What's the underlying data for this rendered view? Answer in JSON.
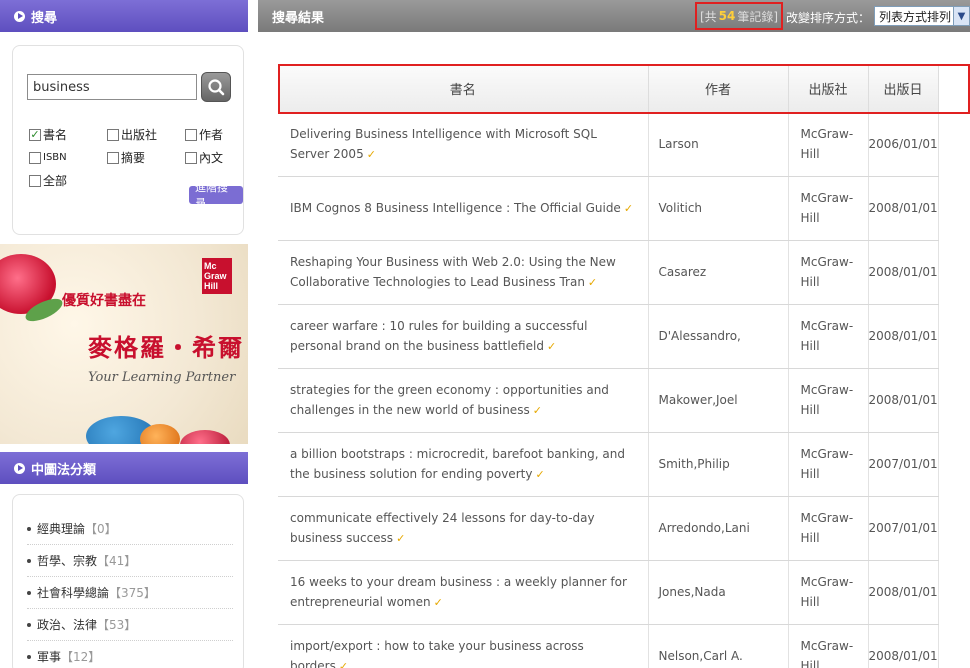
{
  "search_panel": {
    "title": "搜尋",
    "query": "business",
    "checkboxes": [
      {
        "label": "書名",
        "checked": true
      },
      {
        "label": "出版社",
        "checked": false
      },
      {
        "label": "作者",
        "checked": false
      },
      {
        "label": "ISBN",
        "checked": false
      },
      {
        "label": "摘要",
        "checked": false
      },
      {
        "label": "內文",
        "checked": false
      },
      {
        "label": "全部",
        "checked": false
      }
    ],
    "advanced_label": "進階搜尋"
  },
  "banner": {
    "logo_text": "Mc Graw Hill",
    "tagline": "優質好書盡在",
    "brand": "麥格羅・希爾",
    "slogan": "Your Learning Partner"
  },
  "class_panel": {
    "title": "中圖法分類",
    "items": [
      {
        "label": "經典理論",
        "count": "【0】"
      },
      {
        "label": "哲學、宗教",
        "count": "【41】"
      },
      {
        "label": "社會科學總論",
        "count": "【375】"
      },
      {
        "label": "政治、法律",
        "count": "【53】"
      },
      {
        "label": "軍事",
        "count": "【12】"
      }
    ]
  },
  "results": {
    "title": "搜尋結果",
    "count_prefix": "[共",
    "count_value": "54",
    "count_suffix": "筆記錄]",
    "sort_label": "改變排序方式：",
    "sort_selected": "列表方式排列",
    "columns": [
      "書名",
      "作者",
      "出版社",
      "出版日"
    ],
    "rows": [
      {
        "title": "Delivering Business Intelligence with Microsoft SQL Server 2005",
        "author": "Larson",
        "publisher": "McGraw-Hill",
        "date": "2006/01/01"
      },
      {
        "title": "IBM Cognos 8 Business Intelligence : The Official Guide",
        "author": "Volitich",
        "publisher": "McGraw-Hill",
        "date": "2008/01/01"
      },
      {
        "title": "Reshaping Your Business with Web 2.0: Using the New Collaborative Technologies to Lead Business Tran",
        "author": "Casarez",
        "publisher": "McGraw-Hill",
        "date": "2008/01/01"
      },
      {
        "title": "career warfare : 10 rules for building a successful personal brand on the business battlefield",
        "author": "D'Alessandro,",
        "publisher": "McGraw-Hill",
        "date": "2008/01/01"
      },
      {
        "title": "strategies for the green economy : opportunities and challenges in the new world of business",
        "author": "Makower,Joel",
        "publisher": "McGraw-Hill",
        "date": "2008/01/01"
      },
      {
        "title": "a billion bootstraps : microcredit, barefoot banking, and the business solution for ending poverty",
        "author": "Smith,Philip",
        "publisher": "McGraw-Hill",
        "date": "2007/01/01"
      },
      {
        "title": "communicate effectively 24 lessons for day-to-day business success",
        "author": "Arredondo,Lani",
        "publisher": "McGraw-Hill",
        "date": "2007/01/01"
      },
      {
        "title": "16 weeks to your dream business : a weekly planner for entrepreneurial women",
        "author": "Jones,Nada",
        "publisher": "McGraw-Hill",
        "date": "2008/01/01"
      },
      {
        "title": "import/export : how to take your business across borders",
        "author": "Nelson,Carl A.",
        "publisher": "McGraw-Hill",
        "date": "2008/01/01"
      }
    ]
  },
  "colors": {
    "purple_header": "#6a5bc8",
    "gray_header": "#8a8a8a",
    "highlight_red": "#e02020",
    "count_yellow": "#ffcf3a",
    "tick_gold": "#e6a800"
  }
}
